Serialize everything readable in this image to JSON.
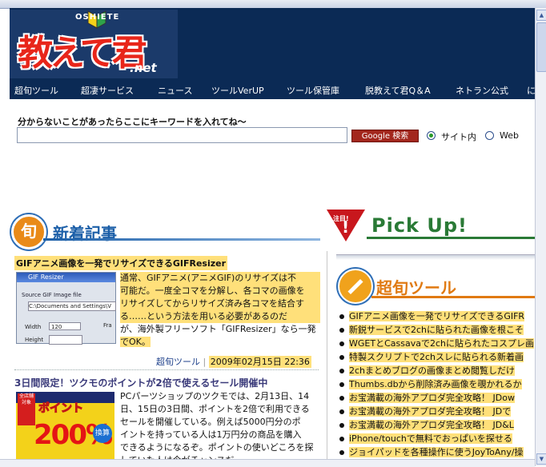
{
  "logo": {
    "top_text": "OSHIETE",
    "main_text": "教えて君",
    "suffix": ".net"
  },
  "nav": {
    "items": [
      "超旬ツール",
      "超凄サービス",
      "ニュース",
      "ツールVerUP",
      "ツール保管庫",
      "脱教えて君Q＆A",
      "ネトラン公式",
      "に"
    ]
  },
  "search": {
    "label": "分からないことがあったらここにキーワードを入れてね～",
    "value": "",
    "button_label": "Google 検索",
    "options": [
      {
        "label": "サイト内",
        "selected": true
      },
      {
        "label": "Web",
        "selected": false
      }
    ]
  },
  "new_articles": {
    "badge": "旬",
    "heading": "新着記事",
    "articles": [
      {
        "title": "GIFアニメ画像を一発でリサイズできるGIFResizer",
        "thumb": {
          "window_title": "GIF Resizer",
          "group_label": "Source GIF Image file",
          "path_value": "C:\\Documents and Settings\\V",
          "width_label": "Width",
          "width_value": "120",
          "height_label": "Height",
          "right_label": "Fra"
        },
        "desc_lines": [
          "通常、GIFアニメ(アニメGIF)のリサイズは不",
          "可能だ。一度全コマを分解し、各コマの画像を",
          "リサイズしてからリサイズ済み各コマを結合す",
          "る……という方法を用いる必要があるのだ",
          "が、海外製フリーソフト「GIFResizer」なら一発",
          "でOK。"
        ],
        "category": "超旬ツール",
        "date": "2009年02月15日 22:36"
      },
      {
        "title": "3日間限定！ツクモのポイントが2倍で使えるセール開催中",
        "thumb": {
          "mark_text": "全店舗対象",
          "point_text": "ポイント",
          "big_text": "200%",
          "badge_text": "換算"
        },
        "desc_lines": [
          "PCパーツショップのツクモでは、2月13日、14",
          "日、15日の3日間、ポイントを2倍で利用できる",
          "セールを開催している。例えば5000円分のポ",
          "イントを持っている人は1万円分の商品を購入",
          "できるようになるぞ。ポイントの使いどころを探",
          "していた人は今がチャンスだ"
        ]
      }
    ]
  },
  "pickup": {
    "warn_label": "注目!",
    "warn_mark": "!",
    "heading": "Pick Up!"
  },
  "chojun": {
    "heading": "超旬ツール",
    "items": [
      "GIFアニメ画像を一発でリサイズできるGIFR",
      "新鋭サービスで2chに貼られた画像を根こそ",
      "WGETとCassavaで2chに貼られたコスプレ画",
      "特製スクリプトで2chスレに貼られる新着画",
      "2chまとめブログの画像まとめ閲覧しだけ",
      "Thumbs.dbから削除済み画像を覗かれるか",
      "お宝満載の海外アプロダ完全攻略！ JDow",
      "お宝満載の海外アプロダ完全攻略！ JDで",
      "お宝満載の海外アプロダ完全攻略！ JD&L",
      "iPhone/touchで無料でおっぱいを探せる",
      "ジョイパッドを各種操作に使うJoyToAny/操"
    ]
  },
  "colors": {
    "header_bg": "#0b2a55",
    "highlight": "#ffe07a",
    "accent_blue": "#1c5fa8",
    "accent_orange": "#e07a12",
    "pick_green": "#2a7a36",
    "button_red": "#a3271d"
  }
}
